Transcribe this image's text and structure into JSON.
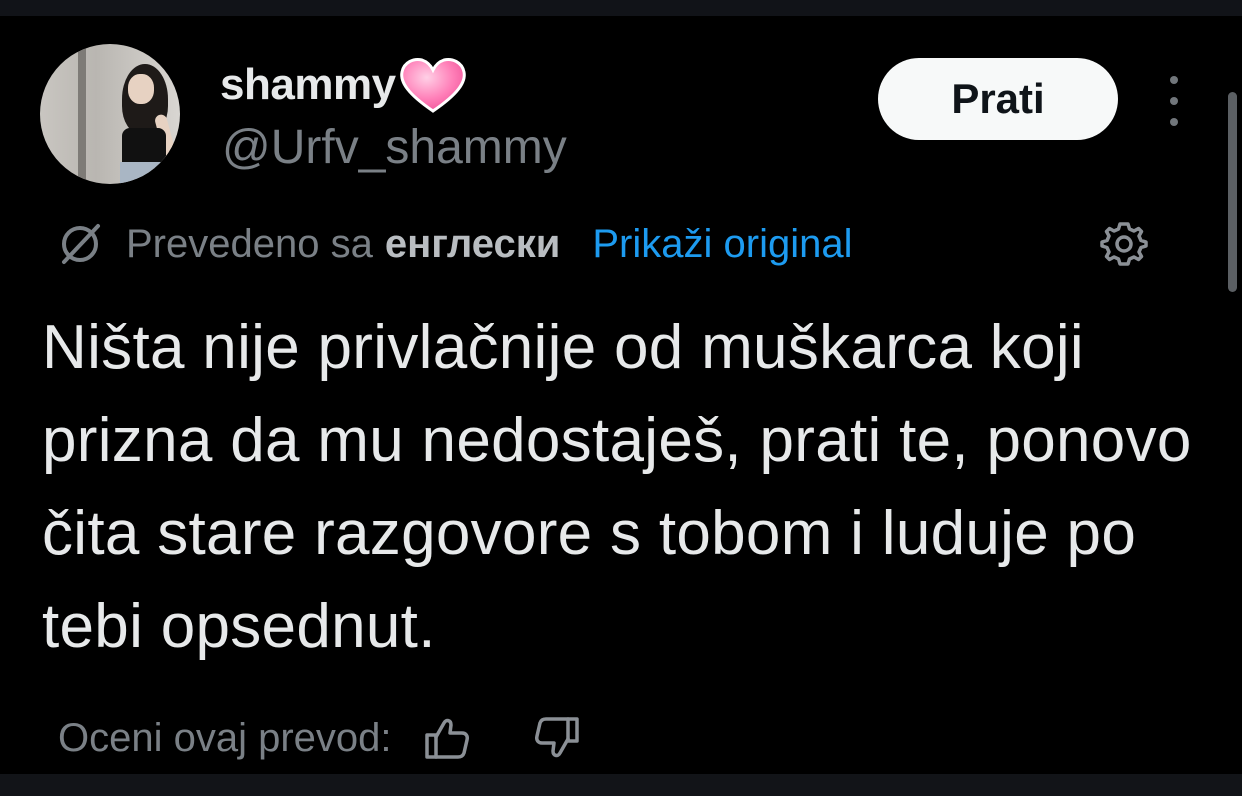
{
  "user": {
    "display_name": "shammy",
    "handle": "@Urfv_shammy",
    "name_emoji": "pink-heart-icon"
  },
  "actions": {
    "follow_label": "Prati",
    "more_icon": "more-vertical-icon"
  },
  "translation": {
    "translated_from": "Prevedeno sa",
    "language": "енглески",
    "show_original": "Prikaži original",
    "icon": "translate-icon",
    "settings_icon": "gear-icon"
  },
  "tweet": {
    "text": "Ništa nije privlačnije od muškarca koji prizna da mu nedostaješ, prati te, ponovo čita stare razgovore s tobom i luduje po tebi opsednut."
  },
  "rating": {
    "label": "Oceni ovaj prevod:",
    "up_icon": "thumbs-up-icon",
    "down_icon": "thumbs-down-icon"
  },
  "colors": {
    "background": "#000000",
    "text_primary": "#e7e9ea",
    "text_secondary": "#7a8086",
    "link": "#1d9bf0",
    "heart": "#ff6fae",
    "button_bg": "#f7f9f9"
  }
}
